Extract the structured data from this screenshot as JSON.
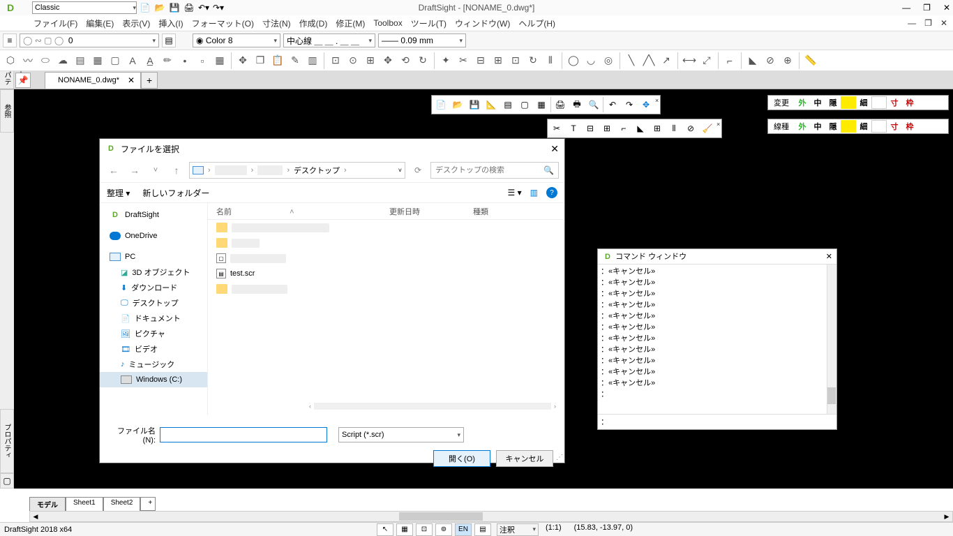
{
  "app": {
    "title": "DraftSight - [NONAME_0.dwg*]",
    "style_select": "Classic"
  },
  "win_controls": {
    "min": "—",
    "max": "❐",
    "close": "✕"
  },
  "child_win": {
    "min": "—",
    "max": "❐",
    "close": "✕"
  },
  "menu": [
    "ファイル(F)",
    "編集(E)",
    "表示(V)",
    "挿入(I)",
    "フォーマット(O)",
    "寸法(N)",
    "作成(D)",
    "修正(M)",
    "Toolbox",
    "ツール(T)",
    "ウィンドウ(W)",
    "ヘルプ(H)"
  ],
  "prop_bar": {
    "layer_current": "0",
    "color": "Color 8",
    "linetype": "中心線 ＿ ＿ . ＿ ＿",
    "lineweight": "—— 0.09 mm"
  },
  "doc_tab": {
    "name": "NONAME_0.dwg*",
    "close": "✕"
  },
  "side": {
    "properties": "プロパティ",
    "ref": "参照"
  },
  "float_tb1_close": "×",
  "float_tb2_close": "×",
  "prop_panel1": {
    "label": "変更",
    "btns": [
      {
        "t": "外",
        "c": "#1bbf1b"
      },
      {
        "t": "中",
        "c": "#333"
      },
      {
        "t": "隠",
        "c": "#333"
      },
      {
        "t": "",
        "c": "#ffeb00"
      },
      {
        "t": "細",
        "c": "#333"
      },
      {
        "t": "",
        "c": "#fff"
      },
      {
        "t": "寸",
        "c": "#c00"
      },
      {
        "t": "枠",
        "c": "#c00"
      }
    ]
  },
  "prop_panel2": {
    "label": "線種",
    "btns": [
      {
        "t": "外",
        "c": "#1bbf1b"
      },
      {
        "t": "中",
        "c": "#333"
      },
      {
        "t": "隠",
        "c": "#333"
      },
      {
        "t": "",
        "c": "#ffeb00"
      },
      {
        "t": "細",
        "c": "#333"
      },
      {
        "t": "",
        "c": "#fff"
      },
      {
        "t": "寸",
        "c": "#c00"
      },
      {
        "t": "枠",
        "c": "#c00"
      }
    ]
  },
  "dialog": {
    "title": "ファイルを選択",
    "close": "✕",
    "nav_back": "←",
    "nav_fwd": "→",
    "nav_up": "↑",
    "addr_crumb": "デスクトップ",
    "addr_sep": "›",
    "refresh": "⟳",
    "search_placeholder": "デスクトップの検索",
    "search_icon": "🔍",
    "toolbar": {
      "organize": "整理 ▾",
      "newfolder": "新しいフォルダー",
      "view": "☰ ▾",
      "preview": "▥",
      "help": "?"
    },
    "tree": [
      {
        "icon": "logo",
        "label": "DraftSight",
        "sub": false
      },
      {
        "icon": "cloud",
        "label": "OneDrive",
        "sub": false
      },
      {
        "icon": "pc",
        "label": "PC",
        "sub": false
      },
      {
        "icon": "cube",
        "label": "3D オブジェクト",
        "sub": true
      },
      {
        "icon": "down",
        "label": "ダウンロード",
        "sub": true
      },
      {
        "icon": "desk",
        "label": "デスクトップ",
        "sub": true
      },
      {
        "icon": "doc",
        "label": "ドキュメント",
        "sub": true
      },
      {
        "icon": "pic",
        "label": "ピクチャ",
        "sub": true
      },
      {
        "icon": "vid",
        "label": "ビデオ",
        "sub": true
      },
      {
        "icon": "music",
        "label": "ミュージック",
        "sub": true
      },
      {
        "icon": "drive",
        "label": "Windows (C:)",
        "sub": true,
        "selected": true
      }
    ],
    "columns": {
      "name": "名前",
      "date": "更新日時",
      "type": "種類",
      "sort": "˄"
    },
    "file_item": "test.scr",
    "filename_label": "ファイル名(N):",
    "filename_value": "",
    "filter": "Script (*.scr)",
    "open_btn": "開く(O)",
    "cancel_btn": "キャンセル"
  },
  "cmd_win": {
    "title": "コマンド ウィンドウ",
    "close": "✕",
    "lines": [
      "：«キャンセル»",
      "：«キャンセル»",
      "：«キャンセル»",
      "：«キャンセル»",
      "：«キャンセル»",
      "：«キャンセル»",
      "：«キャンセル»",
      "：«キャンセル»",
      "：«キャンセル»",
      "：«キャンセル»",
      "：«キャンセル»",
      "："
    ],
    "input_prompt": "："
  },
  "bottom_tabs": {
    "model": "モデル",
    "sheet1": "Sheet1",
    "sheet2": "Sheet2",
    "add": "+"
  },
  "status": {
    "app_version": "DraftSight 2018 x64",
    "anno": "注釈",
    "ratio": "(1:1)",
    "coords": "(15.83, -13.97, 0)"
  }
}
